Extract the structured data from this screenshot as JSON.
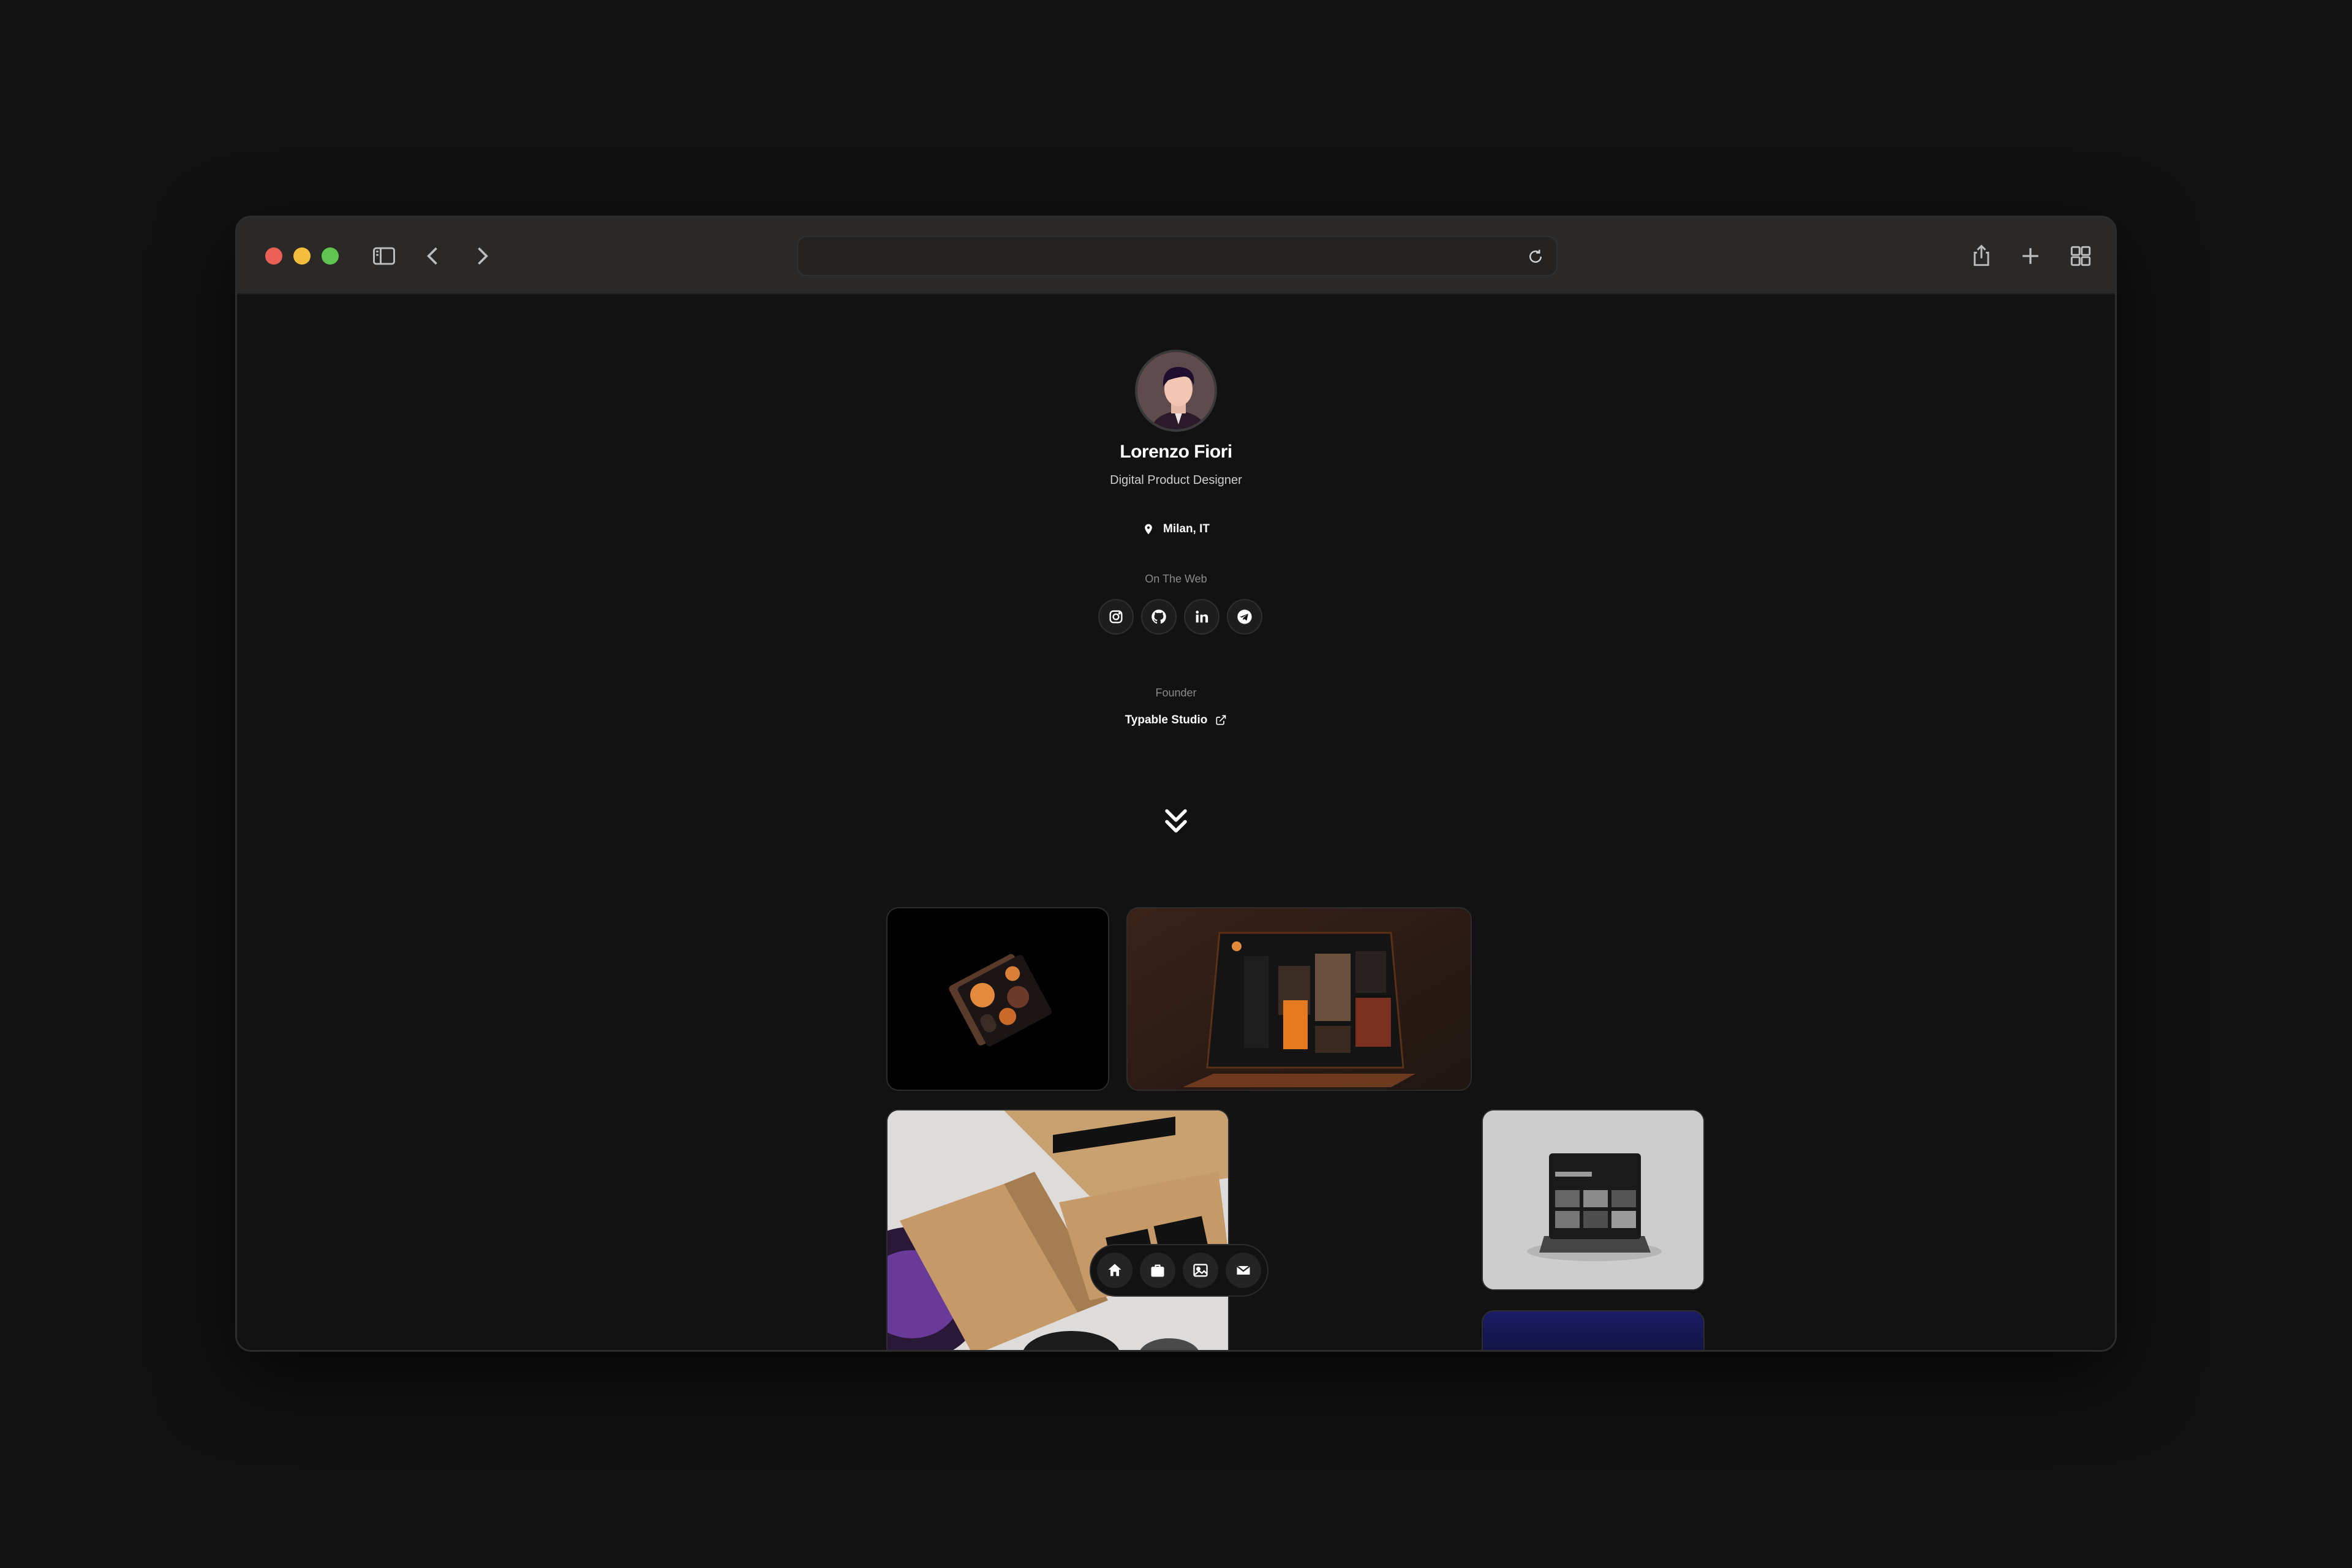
{
  "browser": {
    "traffic_lights": {
      "close": "#ec5f57",
      "minimize": "#f4be3c",
      "zoom": "#5fc54f"
    },
    "icons": [
      "sidebar-icon",
      "back-icon",
      "forward-icon",
      "reload-icon",
      "share-icon",
      "new-tab-icon",
      "tab-overview-icon"
    ]
  },
  "profile": {
    "name": "Lorenzo Fiori",
    "role": "Digital Product Designer",
    "location": "Milan, IT"
  },
  "web": {
    "heading": "On The Web",
    "links": [
      "instagram-icon",
      "github-icon",
      "linkedin-icon",
      "telegram-icon"
    ]
  },
  "work": {
    "heading": "Founder",
    "company": "Typable Studio"
  },
  "dock": {
    "items": [
      "home-icon",
      "briefcase-icon",
      "image-icon",
      "mail-icon"
    ]
  },
  "portfolio": {
    "tiles": [
      "tile-pattern-cards",
      "tile-laptop-orange",
      "tile-wacom-boxes",
      "tile-tablet-mockup",
      "tile-blue-partial"
    ]
  }
}
